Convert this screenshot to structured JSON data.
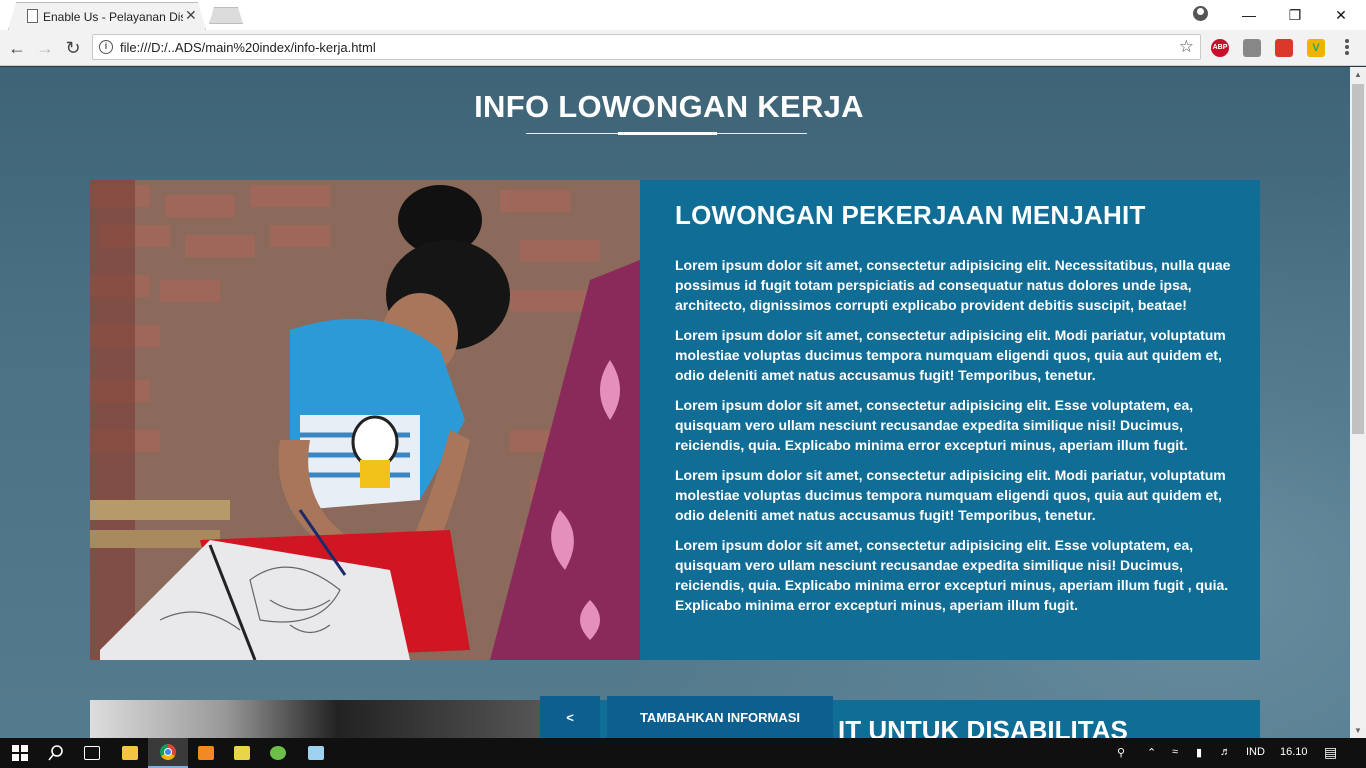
{
  "browser": {
    "tab_title": "Enable Us - Pelayanan Disabilitas",
    "url": "file:///D:/..ADS/main%20index/info-kerja.html",
    "extensions": [
      "abp-icon",
      "camera-icon",
      "people-icon",
      "v-icon"
    ],
    "abp_label": "ABP",
    "v_label": "V"
  },
  "page": {
    "section_title": "INFO LOWONGAN KERJA",
    "card1": {
      "title": "LOWONGAN PEKERJAAN MENJAHIT",
      "paragraphs": [
        "Lorem ipsum dolor sit amet, consectetur adipisicing elit. Necessitatibus, nulla quae possimus id fugit totam perspiciatis ad consequatur natus dolores unde ipsa, architecto, dignissimos corrupti explicabo provident debitis suscipit, beatae!",
        "Lorem ipsum dolor sit amet, consectetur adipisicing elit. Modi pariatur, voluptatum molestiae voluptas ducimus tempora numquam eligendi quos, quia aut quidem et, odio deleniti amet natus accusamus fugit! Temporibus, tenetur.",
        "Lorem ipsum dolor sit amet, consectetur adipisicing elit. Esse voluptatem, ea, quisquam vero ullam nesciunt recusandae expedita similique nisi! Ducimus, reiciendis, quia. Explicabo minima error excepturi minus, aperiam illum fugit.",
        "Lorem ipsum dolor sit amet, consectetur adipisicing elit. Modi pariatur, voluptatum molestiae voluptas ducimus tempora numquam eligendi quos, quia aut quidem et, odio deleniti amet natus accusamus fugit! Temporibus, tenetur.",
        "Lorem ipsum dolor sit amet, consectetur adipisicing elit. Esse voluptatem, ea, quisquam vero ullam nesciunt recusandae expedita similique nisi! Ducimus, reiciendis, quia. Explicabo minima error excepturi minus, aperiam illum fugit , quia. Explicabo minima error excepturi minus, aperiam illum fugit."
      ]
    },
    "card2": {
      "title_partial": "IT UNTUK DISABILITAS"
    },
    "buttons": {
      "prev": "<",
      "add": "TAMBAHKAN INFORMASI"
    }
  },
  "taskbar": {
    "language": "IND",
    "time": "16.10"
  },
  "colors": {
    "card_bg": "#0f6d96",
    "button_bg": "#0c5f8e"
  }
}
